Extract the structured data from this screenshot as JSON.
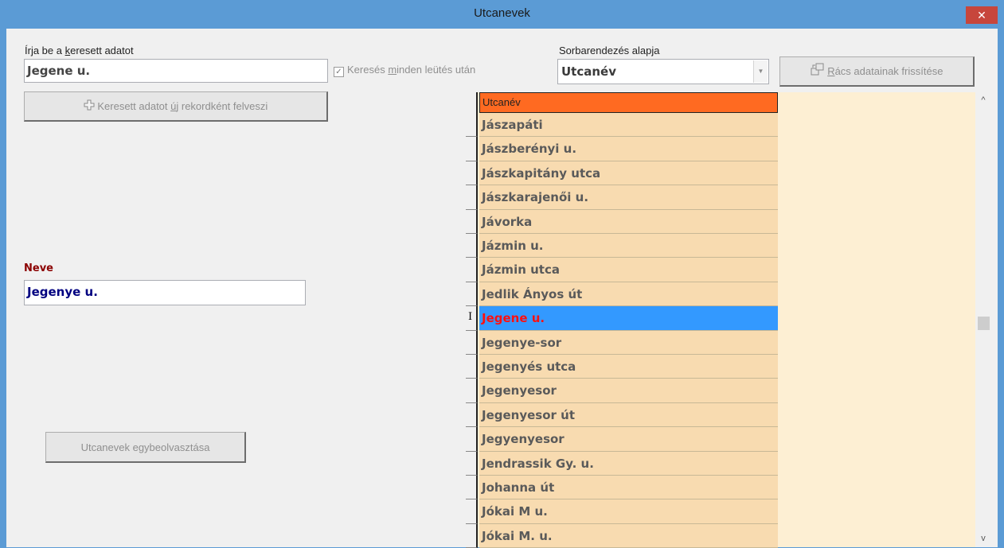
{
  "window": {
    "title": "Utcanevek",
    "close_label": "✕"
  },
  "search": {
    "label_pre": "Írja be a ",
    "label_underline": "k",
    "label_post": "eresett adatot",
    "value": "Jegene u."
  },
  "search_each_keystroke": {
    "checked": true,
    "check_glyph": "☑",
    "label_pre": "Keresés ",
    "label_underline": "m",
    "label_post": "inden leütés után"
  },
  "sort": {
    "label": "Sorbarendezés alapja",
    "value": "Utcanév"
  },
  "refresh_button": {
    "icon": "refresh-grid-icon",
    "label_underline": "R",
    "label_post": "ács adatainak frissítése"
  },
  "add_record_button": {
    "icon": "plus-icon",
    "label_pre": "Keresett adatot ",
    "label_underline": "ú",
    "label_post": "j rekordként felveszi"
  },
  "name_field": {
    "label": "Neve",
    "value": "Jegenye u.",
    "label_color": "#8b0000",
    "value_color": "#000080"
  },
  "merge_button": {
    "label": "Utcanevek egybeolvasztása"
  },
  "grid": {
    "column_header": "Utcanév",
    "rows": [
      "Jászapáti",
      "Jászberényi u.",
      "Jászkapitány utca",
      "Jászkarajenői u.",
      "Jávorka",
      "Jázmin u.",
      "Jázmin utca",
      "Jedlik Ányos út",
      "Jegene u.",
      "Jegenye-sor",
      "Jegenyés utca",
      "Jegenyesor",
      "Jegenyesor út",
      "Jegyenyesor",
      "Jendrassik Gy. u.",
      "Johanna út",
      "Jókai M u.",
      "Jókai M. u."
    ],
    "selected_index": 8,
    "row_indicator_glyph": "I",
    "header_color": "#ff6a21",
    "row_color": "#f8dbb0",
    "selected_color": "#3399ff"
  },
  "scrollbar": {
    "up_glyph": "^",
    "down_glyph": "v"
  }
}
